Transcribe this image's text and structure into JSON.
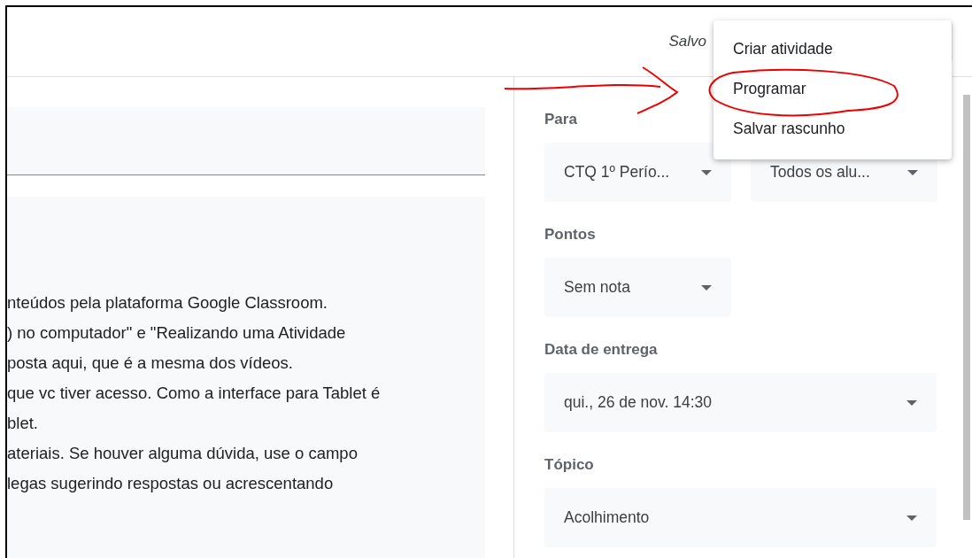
{
  "header": {
    "status": "Salvo"
  },
  "menu": {
    "items": [
      {
        "label": "Criar atividade"
      },
      {
        "label": "Programar"
      },
      {
        "label": "Salvar rascunho"
      }
    ]
  },
  "description": {
    "lines": [
      "nteúdos pela plataforma Google Classroom.",
      ") no computador\" e \"Realizando uma Atividade",
      "posta aqui, que é a mesma dos vídeos.",
      "que vc tiver acesso. Como a interface para Tablet é",
      "blet.",
      "ateriais. Se houver alguma dúvida, use o campo",
      "legas sugerindo respostas ou acrescentando"
    ]
  },
  "sidebar": {
    "sections": [
      {
        "label": "Para",
        "dropdowns": [
          {
            "value": "CTQ 1º Perío...",
            "wide": false
          },
          {
            "value": "Todos os alu...",
            "wide": false
          }
        ]
      },
      {
        "label": "Pontos",
        "dropdowns": [
          {
            "value": "Sem nota",
            "wide": false
          }
        ]
      },
      {
        "label": "Data de entrega",
        "dropdowns": [
          {
            "value": "qui., 26 de nov. 14:30",
            "wide": true
          }
        ]
      },
      {
        "label": "Tópico",
        "dropdowns": [
          {
            "value": "Acolhimento",
            "wide": true
          }
        ]
      }
    ]
  }
}
